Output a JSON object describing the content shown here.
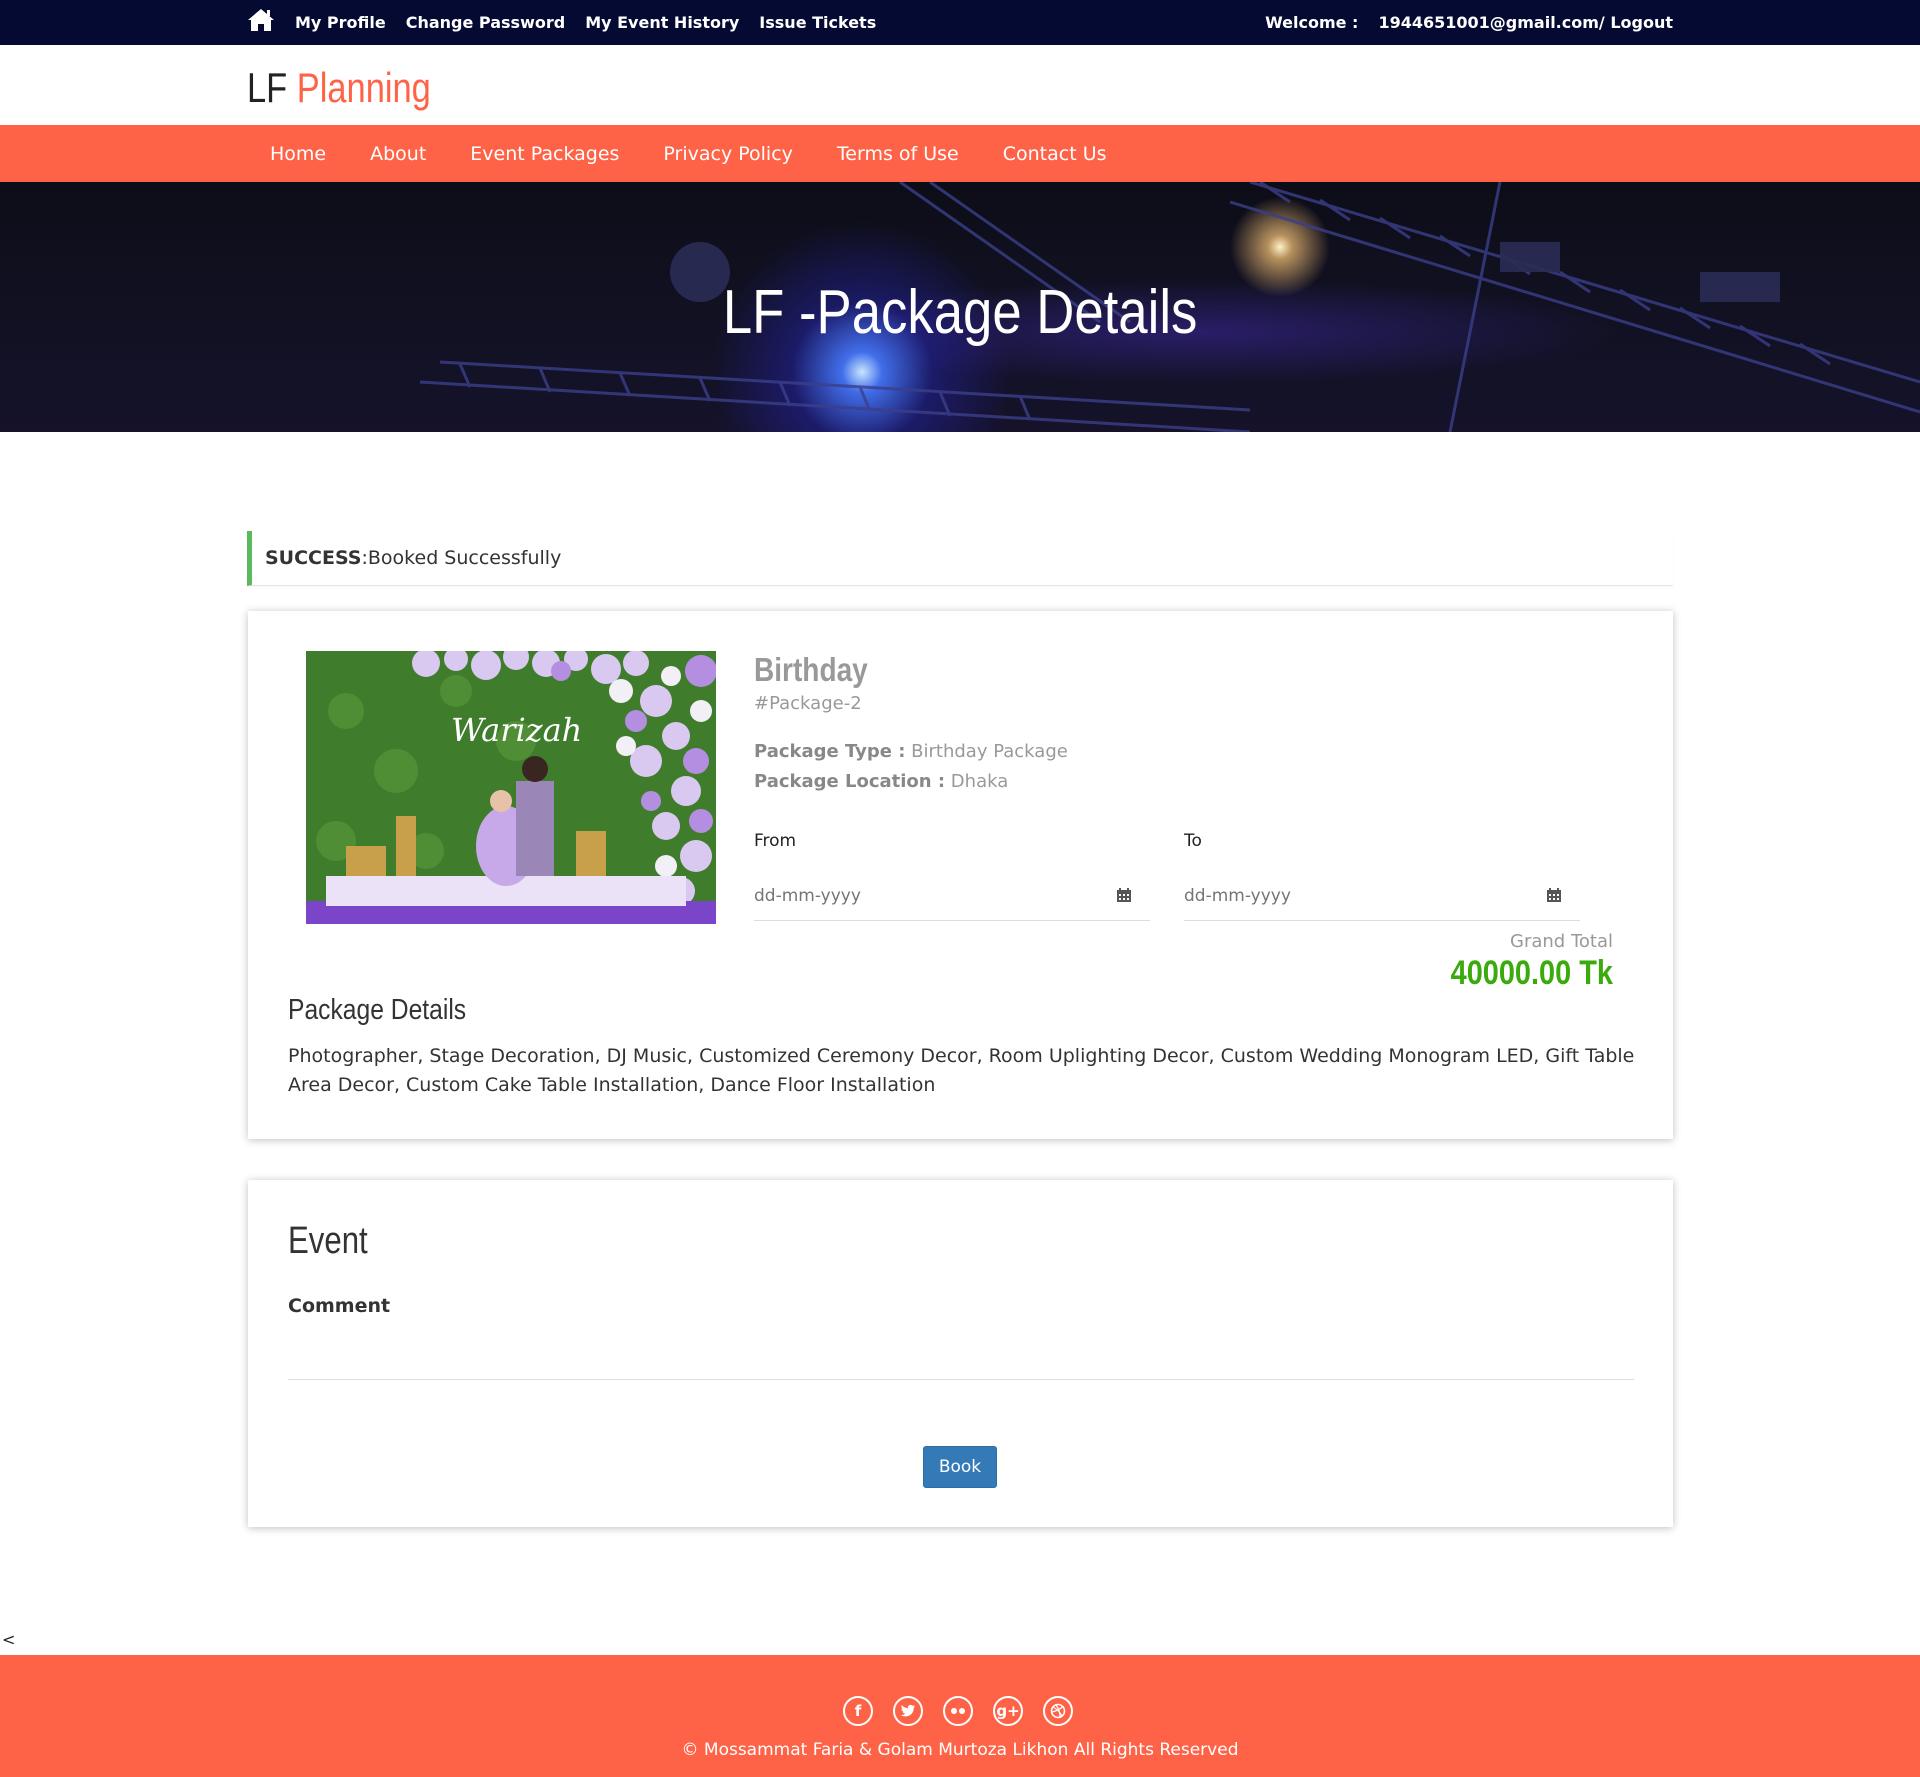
{
  "topbar": {
    "links": [
      "My Profile",
      "Change Password",
      "My Event History",
      "Issue Tickets"
    ],
    "welcome_label": "Welcome :",
    "user_email": "1944651001@gmail.com",
    "logout": " / Logout"
  },
  "logo": {
    "part1": "LF ",
    "part2": "Planning"
  },
  "nav": [
    "Home",
    "About",
    "Event Packages",
    "Privacy Policy",
    "Terms of Use",
    "Contact Us"
  ],
  "hero": {
    "title": "LF -Package Details"
  },
  "alert": {
    "label": "SUCCESS",
    "message": ":Booked Successfully"
  },
  "package": {
    "name": "Birthday",
    "code": "#Package-2",
    "type_label": "Package Type :",
    "type_value": " Birthday Package",
    "location_label": "Package Location :",
    "location_value": " Dhaka",
    "image_text": "Warizah",
    "from_label": "From",
    "to_label": "To",
    "date_placeholder": "dd-mm-yyyy",
    "total_label": "Grand Total",
    "total_value": "40000.00 Tk",
    "details_heading": "Package Details",
    "details_text": "Photographer, Stage Decoration, DJ Music, Customized Ceremony Decor, Room Uplighting Decor, Custom Wedding Monogram LED, Gift Table Area Decor, Custom Cake Table Installation, Dance Floor Installation"
  },
  "event": {
    "heading": "Event",
    "comment_label": "Comment",
    "book_button": "Book"
  },
  "stray_char": "<",
  "footer": {
    "social_icons": [
      "facebook-icon",
      "twitter-icon",
      "flickr-icon",
      "google-plus-icon",
      "dribbble-icon"
    ],
    "copyright": "© Mossammat Faria & Golam Murtoza Likhon All Rights Reserved"
  },
  "colors": {
    "accent": "#ff6347",
    "topbar": "#050a33",
    "success": "#5cb85c",
    "total": "#3aaa0d",
    "button": "#337ab7"
  }
}
